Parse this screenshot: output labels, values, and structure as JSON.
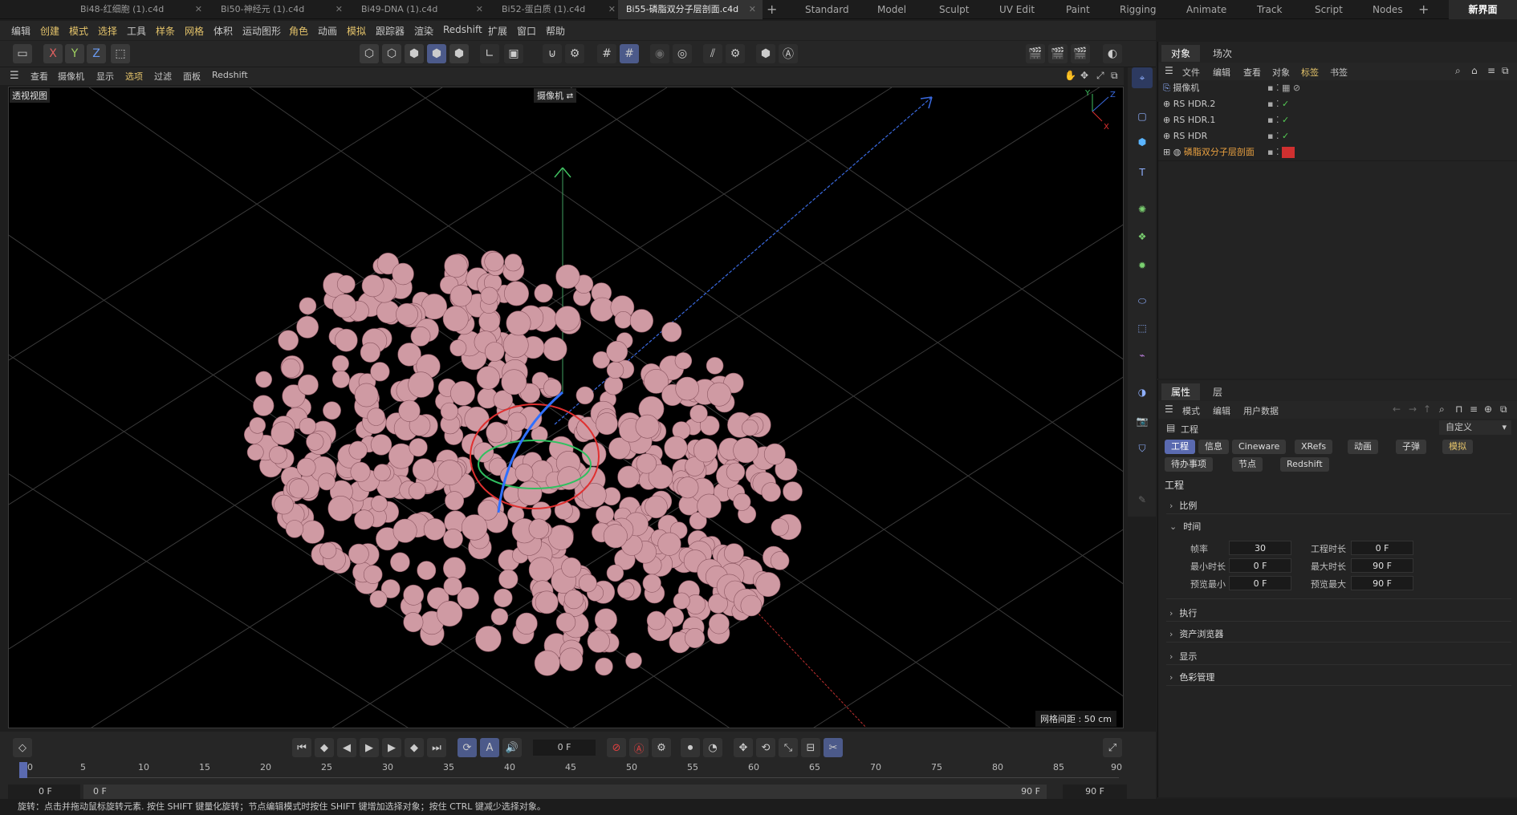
{
  "file_tabs": [
    {
      "label": "Bi48-红细胞 (1).c4d",
      "active": false
    },
    {
      "label": "Bi50-神经元 (1).c4d",
      "active": false
    },
    {
      "label": "Bi49-DNA (1).c4d",
      "active": false
    },
    {
      "label": "Bi52-蛋白质 (1).c4d",
      "active": false
    },
    {
      "label": "Bi55-磷脂双分子层剖面.c4d",
      "active": true
    }
  ],
  "new_tab": "+",
  "layout_tabs": [
    "Standard",
    "Model",
    "Sculpt",
    "UV Edit",
    "Paint",
    "Rigging",
    "Animate",
    "Track",
    "Script",
    "Nodes"
  ],
  "layout_add": "+",
  "new_interface": "新界面",
  "menu": [
    "编辑",
    "创建",
    "模式",
    "选择",
    "工具",
    "样条",
    "网格",
    "体积",
    "运动图形",
    "角色",
    "动画",
    "模拟",
    "跟踪器",
    "渲染",
    "Redshift",
    "扩展",
    "窗口",
    "帮助"
  ],
  "axis_buttons": [
    "X",
    "Y",
    "Z"
  ],
  "viewport_menu": [
    "查看",
    "摄像机",
    "显示",
    "选项",
    "过滤",
    "面板",
    "Redshift"
  ],
  "viewport": {
    "title": "透视视图",
    "camera": "摄像机",
    "grid_distance": "网格间距 : 50 cm",
    "axes": {
      "y": "Y",
      "z": "Z",
      "x": "X"
    }
  },
  "object_panel": {
    "tabs": [
      "对象",
      "场次"
    ],
    "menu": [
      "文件",
      "编辑",
      "查看",
      "对象",
      "标签",
      "书签"
    ],
    "objects": [
      {
        "name": "摄像机",
        "color": "#d0d0d0"
      },
      {
        "name": "RS HDR.2",
        "color": "#d0d0d0"
      },
      {
        "name": "RS HDR.1",
        "color": "#d0d0d0"
      },
      {
        "name": "RS HDR",
        "color": "#d0d0d0"
      },
      {
        "name": "磷脂双分子层剖面",
        "color": "#e8a040"
      }
    ]
  },
  "attr_panel": {
    "tabs": [
      "属性",
      "层"
    ],
    "menu": [
      "模式",
      "编辑",
      "用户数据"
    ],
    "header": "工程",
    "preset": "自定义",
    "chips_row1": [
      "工程",
      "信息",
      "Cineware",
      "XRefs",
      "动画",
      "子弹",
      "模拟"
    ],
    "chips_row2": [
      "待办事项",
      "节点",
      "Redshift"
    ],
    "section_title": "工程",
    "sections_top": [
      "比例",
      "时间"
    ],
    "fields": [
      {
        "label": "帧率",
        "value": "30"
      },
      {
        "label": "工程时长",
        "value": "0 F"
      },
      {
        "label": "最小时长",
        "value": "0 F"
      },
      {
        "label": "最大时长",
        "value": "90 F"
      },
      {
        "label": "预览最小",
        "value": "0 F"
      },
      {
        "label": "预览最大",
        "value": "90 F"
      }
    ],
    "sections_bottom": [
      "执行",
      "资产浏览器",
      "显示",
      "色彩管理"
    ]
  },
  "timeline": {
    "current_frame": "0 F",
    "ticks": [
      "0",
      "5",
      "10",
      "15",
      "20",
      "25",
      "30",
      "35",
      "40",
      "45",
      "50",
      "55",
      "60",
      "65",
      "70",
      "75",
      "80",
      "85",
      "90"
    ],
    "start": "0 F",
    "range_start": "0 F",
    "range_end": "90 F",
    "end": "90 F"
  },
  "status": "旋转：点击并拖动鼠标旋转元素. 按住 SHIFT 键量化旋转；节点编辑模式时按住 SHIFT 键增加选择对象；按住 CTRL 键减少选择对象。",
  "colors": {
    "accent": "#5a6ab0",
    "sphere": "#cf9aa3",
    "active_object": "#e8a040"
  }
}
